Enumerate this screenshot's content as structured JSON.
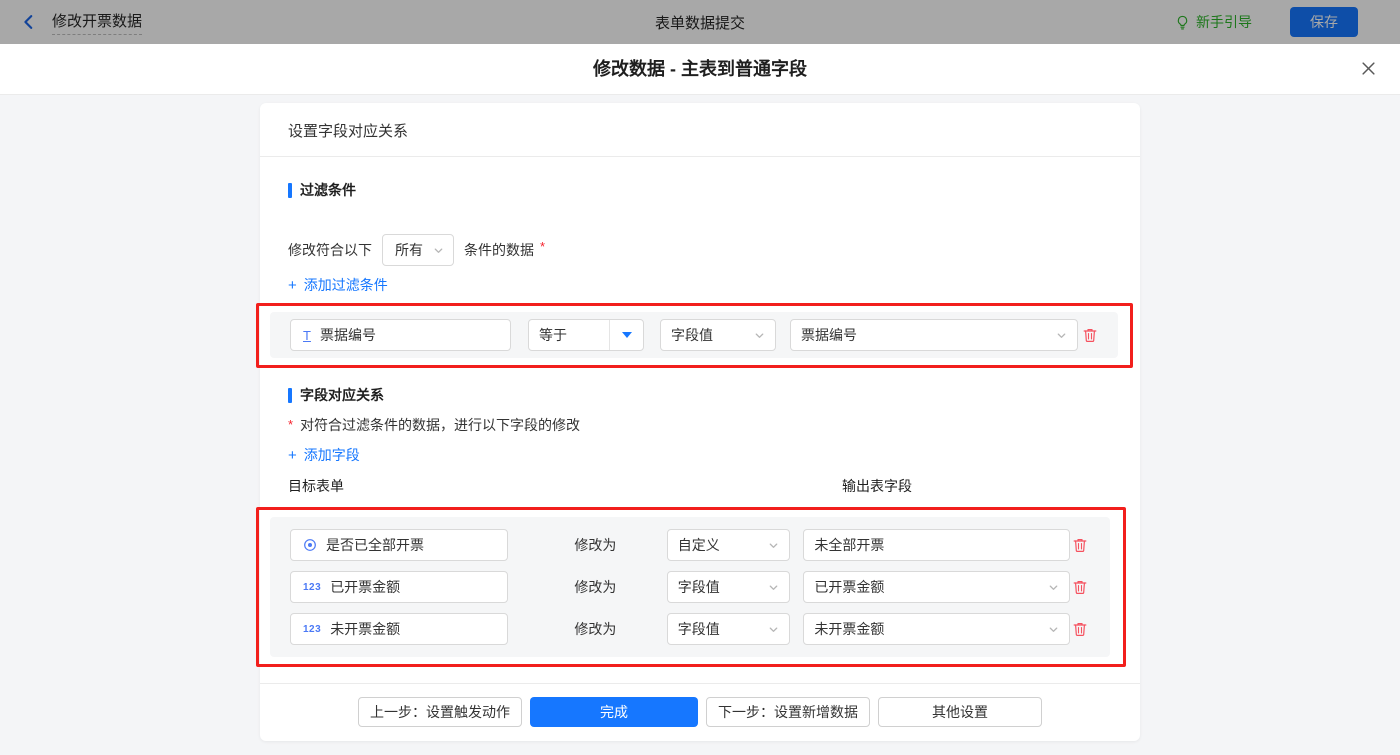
{
  "topbar": {
    "back_label": "修改开票数据",
    "center_title": "表单数据提交",
    "guide_label": "新手引导",
    "save_label": "保存"
  },
  "modal": {
    "title": "修改数据 - 主表到普通字段"
  },
  "card": {
    "header": "设置字段对应关系",
    "filter": {
      "title": "过滤条件",
      "match_prefix": "修改符合以下",
      "match_value": "所有",
      "match_suffix": "条件的数据",
      "required_mark": "*",
      "add_icon": "+",
      "add_label": "添加过滤条件",
      "condition": {
        "field_icon": "T",
        "field": "票据编号",
        "operator": "等于",
        "value_type": "字段值",
        "value_field": "票据编号"
      }
    },
    "mapping": {
      "title": "字段对应关系",
      "required_mark": "*",
      "description": "对符合过滤条件的数据，进行以下字段的修改",
      "add_icon": "+",
      "add_label": "添加字段",
      "col_target": "目标表单",
      "col_output": "输出表字段",
      "rows": [
        {
          "field_icon": "radio",
          "field": "是否已全部开票",
          "verb": "修改为",
          "type": "自定义",
          "value": "未全部开票"
        },
        {
          "field_icon": "123",
          "field": "已开票金额",
          "verb": "修改为",
          "type": "字段值",
          "value": "已开票金额"
        },
        {
          "field_icon": "123",
          "field": "未开票金额",
          "verb": "修改为",
          "type": "字段值",
          "value": "未开票金额"
        }
      ]
    },
    "footer": {
      "prev_label": "上一步：设置触发动作",
      "done_label": "完成",
      "next_label": "下一步：设置新增数据",
      "other_label": "其他设置"
    }
  },
  "colors": {
    "primary": "#1677ff",
    "annotation_red": "#f21f1c",
    "success_green": "#2db529",
    "danger": "#f5515f"
  }
}
